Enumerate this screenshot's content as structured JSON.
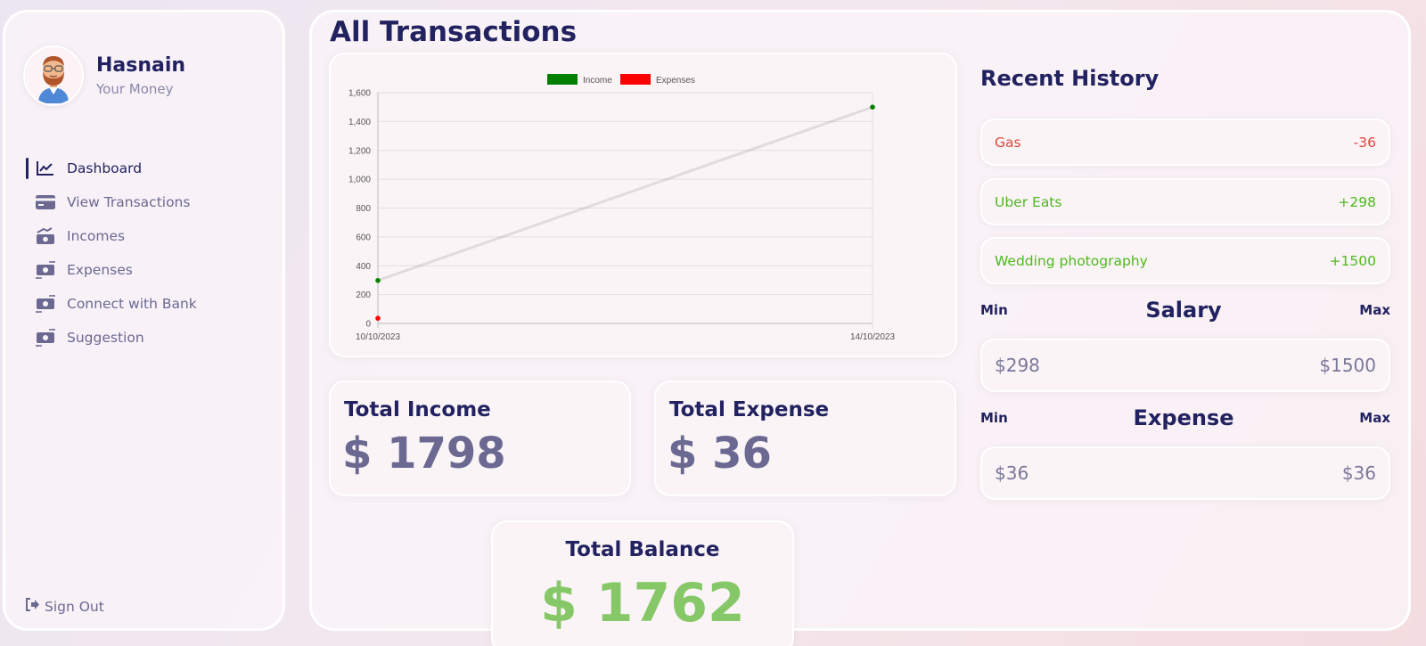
{
  "profile": {
    "name": "Hasnain",
    "subtitle": "Your Money"
  },
  "nav": {
    "items": [
      {
        "label": "Dashboard",
        "icon": "chart-line-icon",
        "active": true
      },
      {
        "label": "View Transactions",
        "icon": "credit-card-icon",
        "active": false
      },
      {
        "label": "Incomes",
        "icon": "money-bill-trend-up-icon",
        "active": false
      },
      {
        "label": "Expenses",
        "icon": "money-bill-transfer-icon",
        "active": false
      },
      {
        "label": "Connect with Bank",
        "icon": "money-bill-transfer-icon",
        "active": false
      },
      {
        "label": "Suggestion",
        "icon": "money-bill-transfer-icon",
        "active": false
      }
    ],
    "signout": "Sign Out"
  },
  "main": {
    "title": "All Transactions"
  },
  "chart_data": {
    "type": "line",
    "x": [
      "10/10/2023",
      "14/10/2023"
    ],
    "series": [
      {
        "name": "Income",
        "color": "#008000",
        "values": [
          298,
          1500
        ]
      },
      {
        "name": "Expenses",
        "color": "#ff0000",
        "values": [
          36,
          null
        ]
      }
    ],
    "yticks": [
      "0",
      "200",
      "400",
      "600",
      "800",
      "1,000",
      "1,200",
      "1,400",
      "1,600"
    ],
    "ylim": [
      0,
      1600
    ],
    "grid": true,
    "legend": "top-center"
  },
  "stats": {
    "income": {
      "title": "Total Income",
      "value": "$ 1798"
    },
    "expense": {
      "title": "Total Expense",
      "value": "$ 36"
    },
    "balance": {
      "title": "Total Balance",
      "value": "$ 1762",
      "color": "#86c867"
    }
  },
  "history": {
    "title": "Recent History",
    "items": [
      {
        "name": "Gas",
        "amount": "-36",
        "type": "expense"
      },
      {
        "name": "Uber Eats",
        "amount": "+298",
        "type": "income"
      },
      {
        "name": "Wedding photography",
        "amount": "+1500",
        "type": "income"
      }
    ]
  },
  "salary": {
    "title": "Salary",
    "min_label": "Min",
    "max_label": "Max",
    "min": "$298",
    "max": "$1500"
  },
  "expense_range": {
    "title": "Expense",
    "min_label": "Min",
    "max_label": "Max",
    "min": "$36",
    "max": "$36"
  },
  "colors": {
    "primary": "#222260",
    "muted": "#6b6991",
    "income": "#4fb81e",
    "expense": "#e0463b"
  }
}
